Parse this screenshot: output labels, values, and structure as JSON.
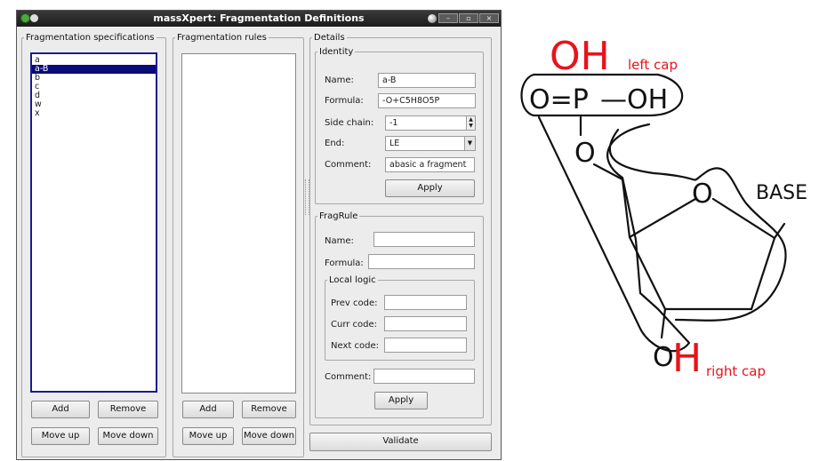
{
  "window": {
    "title": "massXpert: Fragmentation Definitions",
    "wm_buttons": [
      "–",
      "▫",
      "×"
    ]
  },
  "spec_panel": {
    "legend": "Fragmentation specifications",
    "items": [
      "a",
      "a-B",
      "b",
      "c",
      "d",
      "w",
      "x"
    ],
    "selected_index": 1,
    "add_label": "Add",
    "remove_label": "Remove",
    "move_up_label": "Move up",
    "move_down_label": "Move down"
  },
  "rules_panel": {
    "legend": "Fragmentation rules",
    "items": [],
    "add_label": "Add",
    "remove_label": "Remove",
    "move_up_label": "Move up",
    "move_down_label": "Move down"
  },
  "details": {
    "legend": "Details",
    "identity": {
      "legend": "Identity",
      "name_label": "Name:",
      "name_value": "a-B",
      "formula_label": "Formula:",
      "formula_value": "-O+C5H8O5P",
      "side_chain_label": "Side chain:",
      "side_chain_value": "-1",
      "end_label": "End:",
      "end_value": "LE",
      "comment_label": "Comment:",
      "comment_value": "abasic a fragment",
      "apply_label": "Apply"
    },
    "fragrule": {
      "legend": "FragRule",
      "name_label": "Name:",
      "name_value": "",
      "formula_label": "Formula:",
      "formula_value": "",
      "local_logic": {
        "legend": "Local logic",
        "prev_label": "Prev code:",
        "prev_value": "",
        "curr_label": "Curr code:",
        "curr_value": "",
        "next_label": "Next code:",
        "next_value": ""
      },
      "comment_label": "Comment:",
      "comment_value": "",
      "apply_label": "Apply"
    },
    "validate_label": "Validate"
  },
  "diagram": {
    "oh_left": "OH",
    "left_cap": "left cap",
    "o_eq": "O=P",
    "dash_oh": "—OH",
    "ester_o": "O",
    "ring_o": "O",
    "base": "BASE",
    "bottom_o": "O",
    "h_right": "H",
    "right_cap": "right cap",
    "accent_color": "#e8131b",
    "line_color": "#111111"
  }
}
